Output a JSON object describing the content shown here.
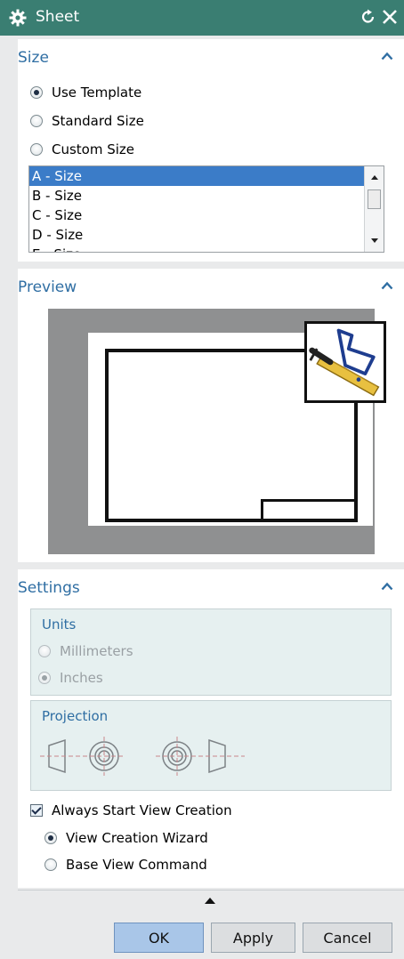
{
  "window": {
    "title": "Sheet",
    "icon": "gear-icon",
    "accent": "#3a7e72"
  },
  "size_section": {
    "header": "Size",
    "options": [
      {
        "label": "Use Template",
        "checked": true
      },
      {
        "label": "Standard Size",
        "checked": false
      },
      {
        "label": "Custom Size",
        "checked": false
      }
    ],
    "template_list": [
      "A - Size",
      "B - Size",
      "C - Size",
      "D - Size",
      "E - Size"
    ],
    "selected_template": "A - Size"
  },
  "preview_section": {
    "header": "Preview"
  },
  "settings_section": {
    "header": "Settings",
    "units": {
      "label": "Units",
      "options": [
        {
          "label": "Millimeters",
          "checked": false,
          "enabled": false
        },
        {
          "label": "Inches",
          "checked": true,
          "enabled": false
        }
      ]
    },
    "projection": {
      "label": "Projection"
    },
    "always_start_view_creation": {
      "label": "Always Start View Creation",
      "checked": true
    },
    "view_options": [
      {
        "label": "View Creation Wizard",
        "checked": true
      },
      {
        "label": "Base View Command",
        "checked": false
      }
    ]
  },
  "buttons": {
    "ok": "OK",
    "apply": "Apply",
    "cancel": "Cancel"
  }
}
